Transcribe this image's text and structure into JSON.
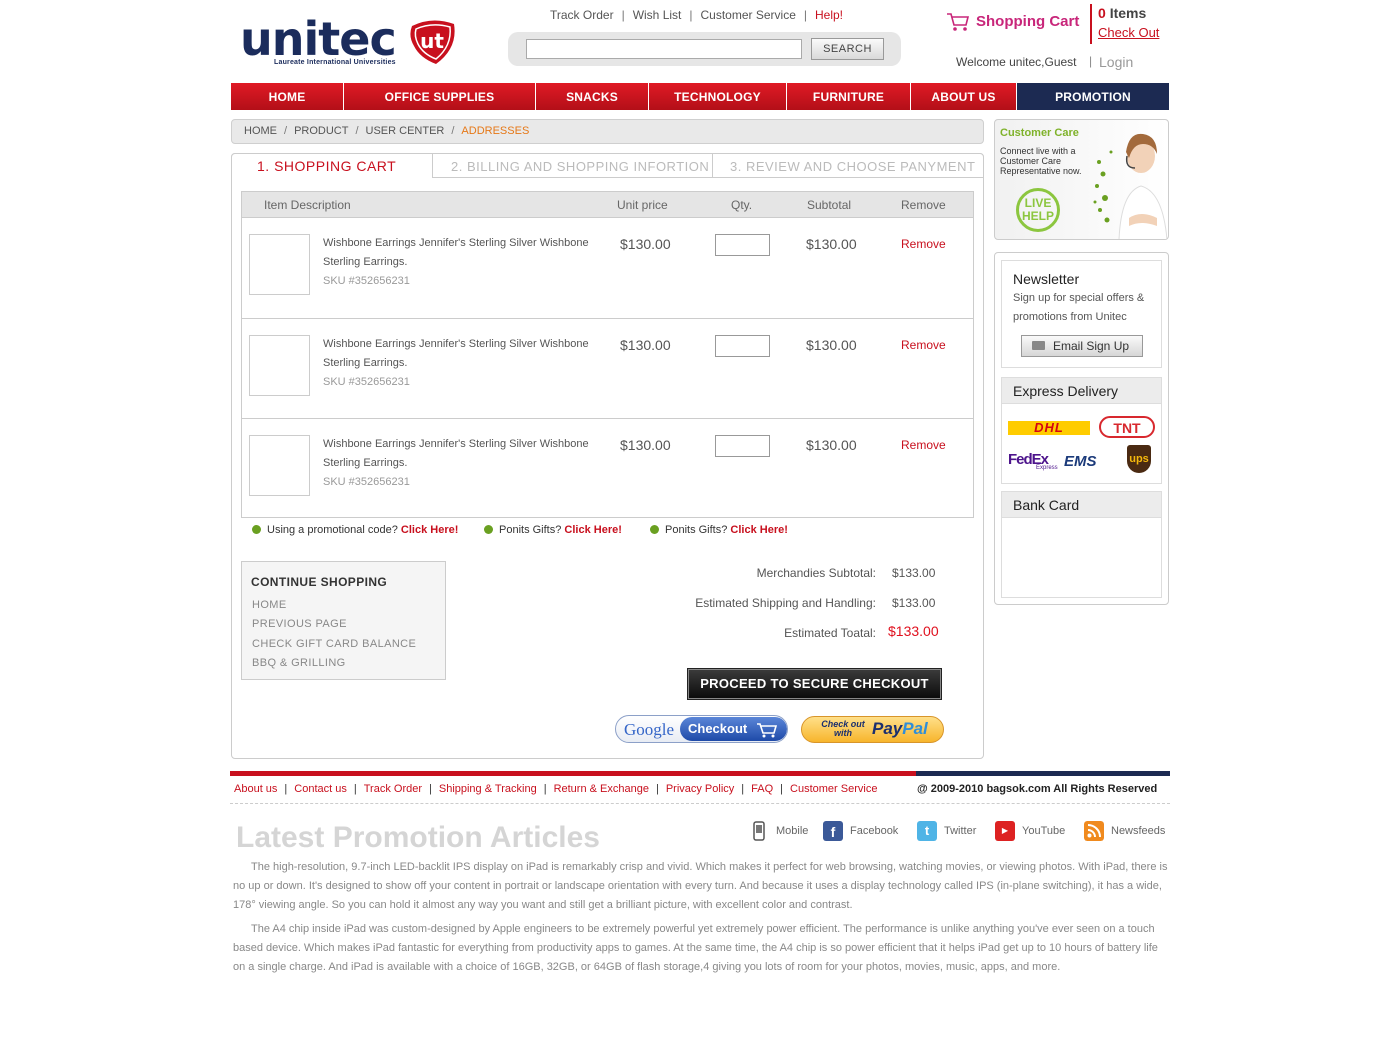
{
  "header": {
    "logo_word": "unitec",
    "logo_badge": "ut",
    "logo_tagline": "Laureate International Universities",
    "top_links": [
      "Track Order",
      "Wish List",
      "Customer Service"
    ],
    "help_link": "Help!",
    "search_placeholder": "",
    "search_button": "SEARCH",
    "cart_title": "Shopping Cart",
    "cart_count": "0",
    "cart_items_label": "Items",
    "checkout_link": "Check Out",
    "welcome": "Welcome unitec,Guest",
    "login": "Login"
  },
  "nav": [
    "HOME",
    "OFFICE SUPPLIES",
    "SNACKS",
    "TECHNOLOGY",
    "FURNITURE",
    "ABOUT US",
    "PROMOTION"
  ],
  "breadcrumb": [
    "HOME",
    "PRODUCT",
    "USER CENTER",
    "ADDRESSES"
  ],
  "steps": [
    "1.  SHOPPING CART",
    "2.  BILLING AND SHOPPING INFORTION",
    "3.  REVIEW AND CHOOSE PANYMENT"
  ],
  "table": {
    "headers": [
      "Item Description",
      "Unit price",
      "Qty.",
      "Subtotal",
      "Remove"
    ],
    "rows": [
      {
        "name": "Wishbone Earrings Jennifer's Sterling Silver Wishbone Sterling Earrings.",
        "sku": "SKU #352656231",
        "price": "$130.00",
        "qty": "",
        "subtotal": "$130.00",
        "remove": "Remove"
      },
      {
        "name": "Wishbone Earrings Jennifer's Sterling Silver Wishbone Sterling Earrings.",
        "sku": "SKU #352656231",
        "price": "$130.00",
        "qty": "",
        "subtotal": "$130.00",
        "remove": "Remove"
      },
      {
        "name": "Wishbone Earrings Jennifer's Sterling Silver Wishbone Sterling Earrings.",
        "sku": "SKU #352656231",
        "price": "$130.00",
        "qty": "",
        "subtotal": "$130.00",
        "remove": "Remove"
      }
    ]
  },
  "promos": [
    {
      "text": "Using a promotional code?",
      "link": "Click Here!"
    },
    {
      "text": "Ponits Gifts?",
      "link": "Click Here!"
    },
    {
      "text": "Ponits Gifts?",
      "link": "Click Here!"
    }
  ],
  "continue": {
    "title": "CONTINUE SHOPPING",
    "links": [
      "HOME",
      "PREVIOUS PAGE",
      "CHECK GIFT CARD BALANCE",
      "BBQ & GRILLING"
    ]
  },
  "totals": {
    "subtotal_label": "Merchandies Subtotal:",
    "subtotal_value": "$133.00",
    "shipping_label": "Estimated Shipping and Handling:",
    "shipping_value": "$133.00",
    "total_label": "Estimated Toatal:",
    "total_value": "$133.00"
  },
  "checkout_button": "PROCEED TO SECURE CHECKOUT",
  "google_checkout": {
    "brand": "Google",
    "label": "Checkout"
  },
  "paypal": {
    "prefix": "Check out with",
    "brand_a": "Pay",
    "brand_b": "Pal"
  },
  "sidebar": {
    "care_title": "Customer Care",
    "care_desc": "Connect live with a Customer Care Representative now.",
    "live_help": "LIVE HELP",
    "newsletter_title": "Newsletter",
    "newsletter_desc": "Sign up for special offers & promotions from Unitec",
    "email_button": "Email Sign Up",
    "express_title": "Express Delivery",
    "carriers": [
      "DHL",
      "TNT",
      "FedEx",
      "Express",
      "EMS",
      "ups"
    ],
    "bank_title": "Bank Card"
  },
  "footer": {
    "links": [
      "About us",
      "Contact us",
      "Track Order",
      "Shipping & Tracking",
      "Return & Exchange",
      "Privacy Policy",
      "FAQ",
      "Customer Service"
    ],
    "copyright": "@ 2009-2010 bagsok.com  All Rights Reserved",
    "articles_title": "Latest Promotion Articles",
    "social": [
      "Mobile",
      "Facebook",
      "Twitter",
      "YouTube",
      "Newsfeeds"
    ],
    "paragraphs": [
      "The high-resolution, 9.7-inch LED-backlit IPS display on iPad is remarkably crisp and vivid. Which makes it perfect for web browsing, watching movies, or viewing photos. With iPad, there is no up or down. It's designed to show off your content in portrait or landscape orientation with every turn. And because it uses a display technology called IPS (in-plane switching), it has a wide, 178° viewing angle. So you can hold it almost any way you want and still get a brilliant picture, with excellent color and contrast.",
      "The A4 chip inside iPad was custom-designed by Apple engineers to be extremely powerful yet extremely power efficient. The performance is unlike anything you've ever seen on a touch based device. Which makes iPad fantastic for everything from productivity apps to games. At the same time, the A4 chip is so power efficient that it helps iPad get up to 10 hours of battery life on a single charge. And iPad is available with a choice of 16GB, 32GB, or 64GB of flash storage,4 giving you lots of room for your photos, movies, music, apps, and more."
    ]
  },
  "colors": {
    "brand_red": "#c8101e",
    "brand_navy": "#1c2a52",
    "accent_orange": "#e67817",
    "cart_pink": "#c8267a",
    "care_green": "#7fb22a"
  }
}
